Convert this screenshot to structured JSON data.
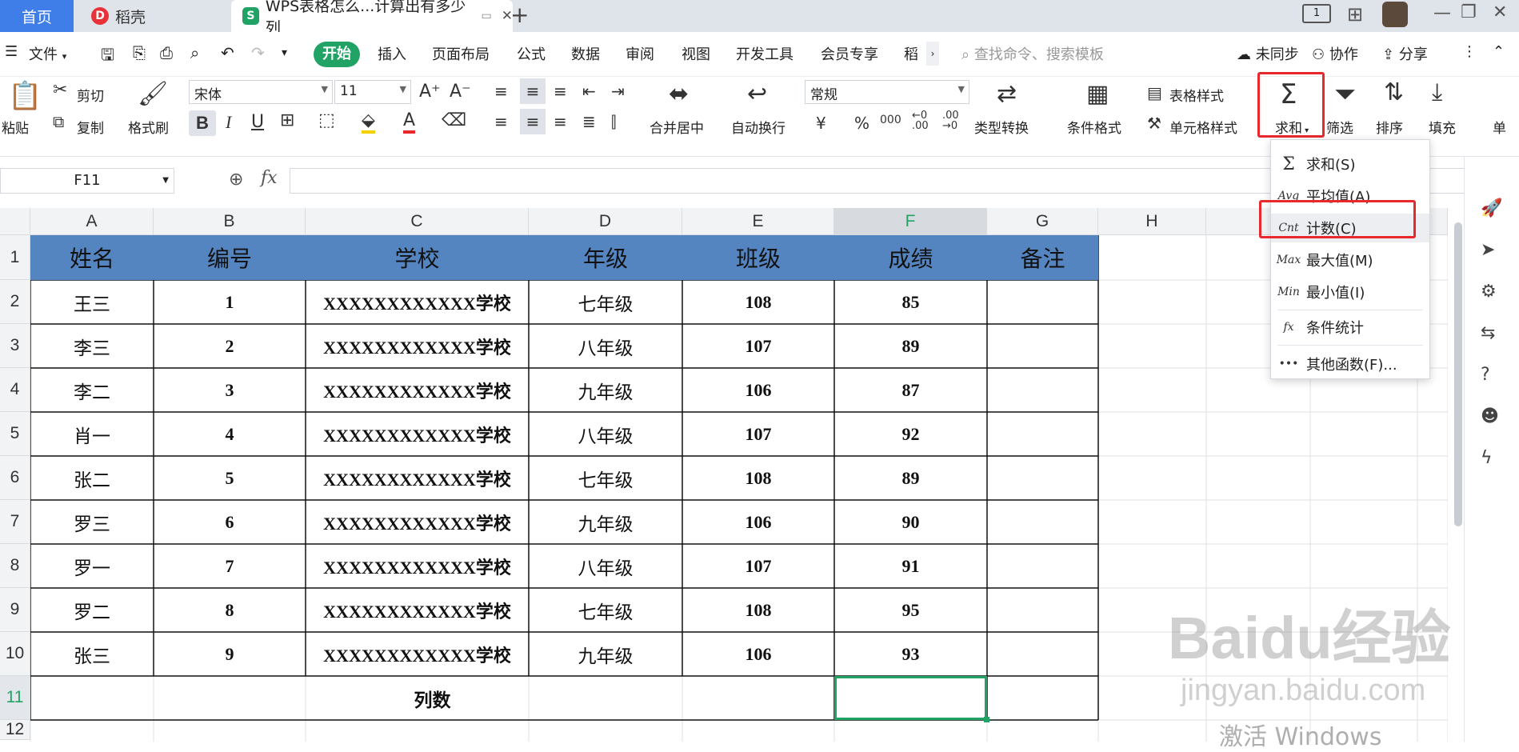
{
  "titlebar": {
    "tab_home": "首页",
    "tab_daoke": "稻壳",
    "tab_doc": "WPS表格怎么...计算出有多少列",
    "new_tab": "+"
  },
  "menubar": {
    "file": "文件",
    "items": [
      "开始",
      "插入",
      "页面布局",
      "公式",
      "数据",
      "审阅",
      "视图",
      "开发工具",
      "会员专享",
      "稻"
    ],
    "search_placeholder": "查找命令、搜索模板",
    "sync": "未同步",
    "collab": "协作",
    "share": "分享"
  },
  "ribbon": {
    "paste": "粘贴",
    "cut": "剪切",
    "copy": "复制",
    "format_painter": "格式刷",
    "font_name": "宋体",
    "font_size": "11",
    "merge_center": "合并居中",
    "wrap_text": "自动换行",
    "number_format": "常规",
    "currency": "¥",
    "percent": "%",
    "thousands": "000",
    "type_convert": "类型转换",
    "cond_format": "条件格式",
    "table_style": "表格样式",
    "cell_style": "单元格样式",
    "sum": "求和",
    "filter": "筛选",
    "sort": "排序",
    "fill": "填充",
    "single": "单"
  },
  "formula_bar": {
    "name_box": "F11",
    "fx": "fx",
    "formula": ""
  },
  "columns": [
    "A",
    "B",
    "C",
    "D",
    "E",
    "F",
    "G",
    "H"
  ],
  "rows": [
    "1",
    "2",
    "3",
    "4",
    "5",
    "6",
    "7",
    "8",
    "9",
    "10",
    "11",
    "12"
  ],
  "table": {
    "headers": [
      "姓名",
      "编号",
      "学校",
      "年级",
      "班级",
      "成绩",
      "备注"
    ],
    "data": [
      [
        "王三",
        "1",
        "XXXXXXXXXXXX学校",
        "七年级",
        "108",
        "85",
        ""
      ],
      [
        "李三",
        "2",
        "XXXXXXXXXXXX学校",
        "八年级",
        "107",
        "89",
        ""
      ],
      [
        "李二",
        "3",
        "XXXXXXXXXXXX学校",
        "九年级",
        "106",
        "87",
        ""
      ],
      [
        "肖一",
        "4",
        "XXXXXXXXXXXX学校",
        "八年级",
        "107",
        "92",
        ""
      ],
      [
        "张二",
        "5",
        "XXXXXXXXXXXX学校",
        "七年级",
        "108",
        "89",
        ""
      ],
      [
        "罗三",
        "6",
        "XXXXXXXXXXXX学校",
        "九年级",
        "106",
        "90",
        ""
      ],
      [
        "罗一",
        "7",
        "XXXXXXXXXXXX学校",
        "八年级",
        "107",
        "91",
        ""
      ],
      [
        "罗二",
        "8",
        "XXXXXXXXXXXX学校",
        "七年级",
        "108",
        "95",
        ""
      ],
      [
        "张三",
        "9",
        "XXXXXXXXXXXX学校",
        "九年级",
        "106",
        "93",
        ""
      ]
    ],
    "footer_label": "列数",
    "header_color": "#5585c1"
  },
  "dropdown": {
    "items": [
      {
        "icon": "Σ",
        "label": "求和(S)"
      },
      {
        "icon": "Avg",
        "label": "平均值(A)"
      },
      {
        "icon": "Cnt",
        "label": "计数(C)"
      },
      {
        "icon": "Max",
        "label": "最大值(M)"
      },
      {
        "icon": "Min",
        "label": "最小值(I)"
      },
      {
        "icon": "fx",
        "label": "条件统计"
      },
      {
        "icon": "•••",
        "label": "其他函数(F)..."
      }
    ]
  },
  "watermark": {
    "baidu": "Baidu经验",
    "site": "jingyan.baidu.com",
    "activate": "激活 Windows"
  },
  "colors": {
    "accent_green": "#21a366",
    "highlight_red": "#e8282c",
    "tab_blue": "#3f7de8"
  }
}
